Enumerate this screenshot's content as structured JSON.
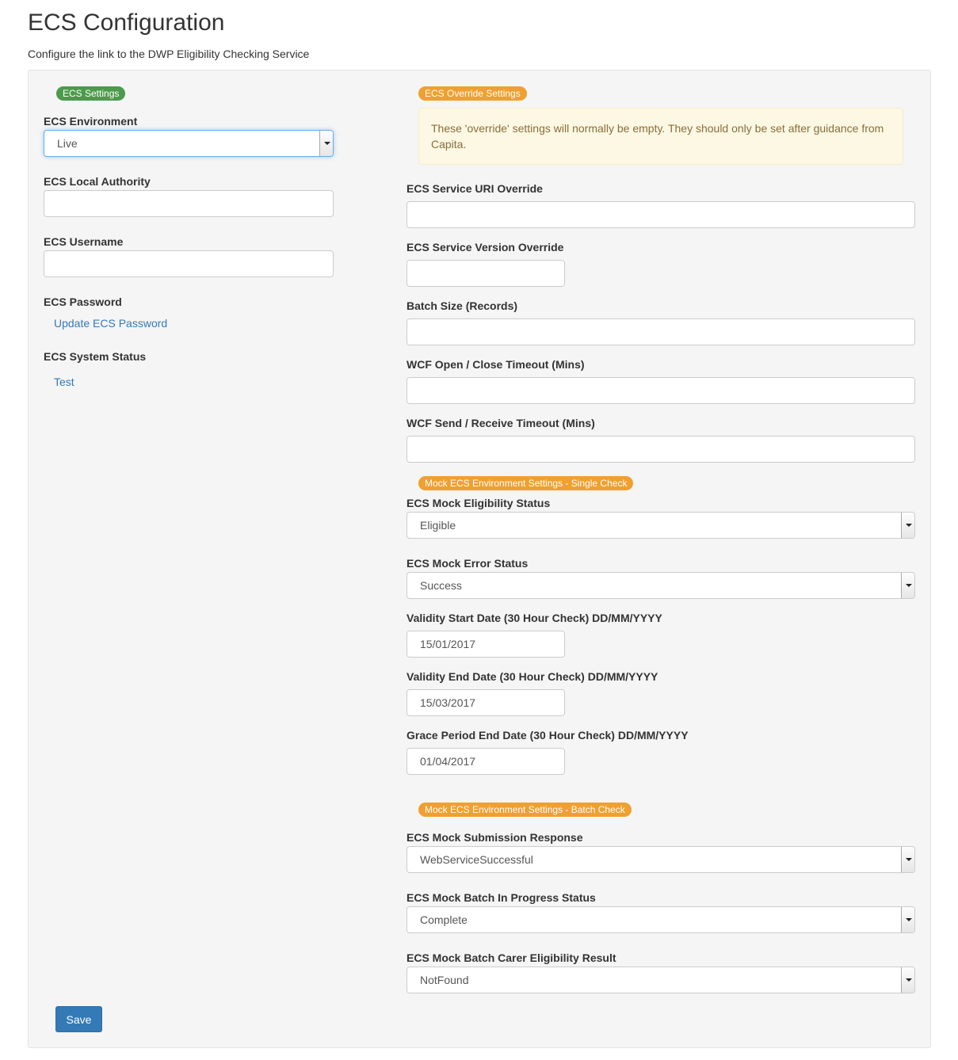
{
  "page": {
    "title": "ECS Configuration",
    "subtitle": "Configure the link to the DWP Eligibility Checking Service"
  },
  "ecs_settings": {
    "badge": "ECS Settings",
    "environment_label": "ECS Environment",
    "environment_value": "Live",
    "local_authority_label": "ECS Local Authority",
    "local_authority_value": "",
    "username_label": "ECS Username",
    "username_value": "",
    "password_label": "ECS Password",
    "update_password_link": "Update ECS Password",
    "system_status_label": "ECS System Status",
    "test_link": "Test"
  },
  "override_settings": {
    "badge": "ECS Override Settings",
    "alert_text": "These 'override' settings will normally be empty. They should only be set after guidance from Capita.",
    "service_uri_label": "ECS Service URI Override",
    "service_uri_value": "",
    "service_version_label": "ECS Service Version Override",
    "service_version_value": "",
    "batch_size_label": "Batch Size (Records)",
    "batch_size_value": "",
    "wcf_open_close_label": "WCF Open / Close Timeout (Mins)",
    "wcf_open_close_value": "",
    "wcf_send_receive_label": "WCF Send / Receive Timeout (Mins)",
    "wcf_send_receive_value": ""
  },
  "mock_single": {
    "badge": "Mock ECS Environment Settings - Single Check",
    "eligibility_status_label": "ECS Mock Eligibility Status",
    "eligibility_status_value": "Eligible",
    "error_status_label": "ECS Mock Error Status",
    "error_status_value": "Success",
    "validity_start_label": "Validity Start Date (30 Hour Check) DD/MM/YYYY",
    "validity_start_value": "15/01/2017",
    "validity_end_label": "Validity End Date (30 Hour Check) DD/MM/YYYY",
    "validity_end_value": "15/03/2017",
    "grace_period_label": "Grace Period End Date (30 Hour Check) DD/MM/YYYY",
    "grace_period_value": "01/04/2017"
  },
  "mock_batch": {
    "badge": "Mock ECS Environment Settings - Batch Check",
    "submission_response_label": "ECS Mock Submission Response",
    "submission_response_value": "WebServiceSuccessful",
    "batch_in_progress_label": "ECS Mock Batch In Progress Status",
    "batch_in_progress_value": "Complete",
    "carer_eligibility_label": "ECS Mock Batch Carer Eligibility Result",
    "carer_eligibility_value": "NotFound"
  },
  "actions": {
    "save_label": "Save"
  },
  "colors": {
    "green_badge": "#4c9a4c",
    "orange_badge": "#f0a030",
    "link": "#337ab7",
    "primary_button": "#337ab7",
    "alert_bg": "#fcf8e3",
    "alert_text": "#8a6d3b"
  }
}
